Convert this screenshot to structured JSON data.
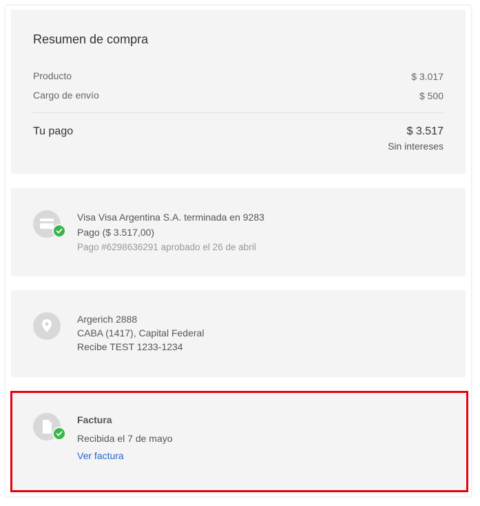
{
  "summary": {
    "title": "Resumen de compra",
    "product_label": "Producto",
    "product_value": "$ 3.017",
    "shipping_label": "Cargo de envío",
    "shipping_value": "$ 500",
    "total_label": "Tu pago",
    "total_value": "$ 3.517",
    "total_note": "Sin intereses"
  },
  "payment": {
    "icon": "credit-card-icon",
    "card_line": "Visa Visa Argentina S.A. terminada en 9283",
    "amount_line": "Pago ($ 3.517,00)",
    "status_line": "Pago #6298636291 aprobado el 26 de abril"
  },
  "address": {
    "icon": "location-pin-icon",
    "street": "Argerich 2888",
    "city": "CABA (1417), Capital Federal",
    "receiver": "Recibe TEST 1233-1234"
  },
  "invoice": {
    "icon": "document-icon",
    "title": "Factura",
    "status": "Recibida el 7 de mayo",
    "link_label": "Ver factura"
  },
  "colors": {
    "card_bg": "#f4f4f4",
    "success": "#39b54a",
    "link": "#2968c8",
    "highlight": "#e8000b"
  }
}
